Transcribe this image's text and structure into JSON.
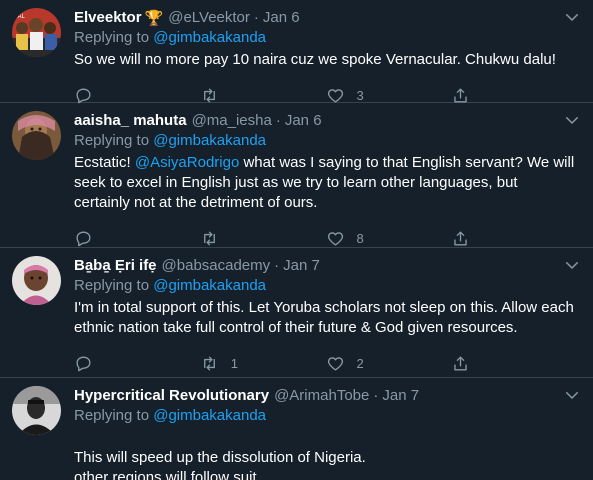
{
  "tweets": [
    {
      "name": "Elveektor",
      "badge": "🏆",
      "handle": "@eLVeektor",
      "time": "Jan 6",
      "replying_prefix": "Replying to ",
      "replying_to": "@gimbakakanda",
      "text_parts": [
        {
          "t": "So we will no more pay 10 naira cuz we spoke Vernacular. Chukwu dalu!",
          "mention": false
        }
      ],
      "reply_count": "",
      "retweet_count": "",
      "like_count": "3",
      "avatar_icon": "group-photo-avatar"
    },
    {
      "name": "aaisha_ mahuta",
      "badge": "",
      "handle": "@ma_iesha",
      "time": "Jan 6",
      "replying_prefix": "Replying to ",
      "replying_to": "@gimbakakanda",
      "text_parts": [
        {
          "t": "Ecstatic! ",
          "mention": false
        },
        {
          "t": "@AsiyaRodrigo",
          "mention": true
        },
        {
          "t": " what was I saying to that English servant? We will seek to excel in English just as we try to learn other languages, but certainly not at the detriment of ours.",
          "mention": false
        }
      ],
      "reply_count": "",
      "retweet_count": "",
      "like_count": "8",
      "avatar_icon": "veiled-woman-avatar"
    },
    {
      "name": "Ba̱ba̱ Ẹri ifẹ",
      "badge": "",
      "handle": "@babsacademy",
      "time": "Jan 7",
      "replying_prefix": "Replying to ",
      "replying_to": "@gimbakakanda",
      "text_parts": [
        {
          "t": "I'm in total support of this. Let Yoruba scholars not sleep on this. Allow each ethnic nation take full control of their future & God given resources.",
          "mention": false
        }
      ],
      "reply_count": "",
      "retweet_count": "1",
      "like_count": "2",
      "avatar_icon": "baby-avatar"
    },
    {
      "name": "Hypercritical Revolutionary",
      "badge": "",
      "handle": "@ArimahTobe",
      "time": "Jan 7",
      "replying_prefix": "Replying to ",
      "replying_to": "@gimbakakanda",
      "text_parts": [
        {
          "t": "This will speed up the dissolution of Nigeria.\nother regions will follow suit",
          "mention": false
        }
      ],
      "reply_count": "",
      "retweet_count": "",
      "like_count": "",
      "avatar_icon": "bw-portrait-avatar"
    }
  ],
  "colors": {
    "background": "#15202b",
    "divider": "#38444d",
    "secondary_text": "#8899a6",
    "accent": "#1da1f2",
    "primary_text": "#ffffff"
  }
}
